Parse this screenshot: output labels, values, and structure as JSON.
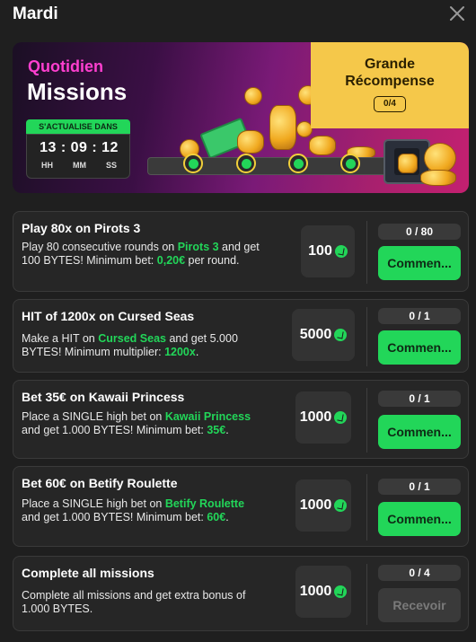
{
  "header": {
    "title": "Mardi"
  },
  "banner": {
    "heading_small": "Quotidien",
    "heading_big": "Missions",
    "timer": {
      "label": "S'ACTUALISE DANS",
      "hh": "13",
      "mm": "09",
      "ss": "12",
      "unit_h": "HH",
      "unit_m": "MM",
      "unit_s": "SS"
    },
    "reward": {
      "title_line1": "Grande",
      "title_line2": "Récompense",
      "count": "0/4"
    }
  },
  "missions": [
    {
      "title": "Play 80x on Pirots 3",
      "desc_a": "Play 80 consecutive rounds on ",
      "desc_hl1": "Pirots 3",
      "desc_b": " and get 100 BYTES! Minimum bet: ",
      "desc_hl2": "0,20€",
      "desc_c": " per round.",
      "reward": "100",
      "progress": "0 / 80",
      "button": "Commen..."
    },
    {
      "title": "HIT of 1200x on Cursed Seas",
      "desc_a": "Make a HIT on ",
      "desc_hl1": "Cursed Seas",
      "desc_b": " and get 5.000 BYTES! Minimum multiplier: ",
      "desc_hl2": "1200x",
      "desc_c": ".",
      "reward": "5000",
      "progress": "0 / 1",
      "button": "Commen..."
    },
    {
      "title": "Bet 35€ on Kawaii Princess",
      "desc_a": "Place a SINGLE high bet on ",
      "desc_hl1": "Kawaii Princess",
      "desc_b": " and get 1.000 BYTES! Minimum bet: ",
      "desc_hl2": "35€",
      "desc_c": ".",
      "reward": "1000",
      "progress": "0 / 1",
      "button": "Commen..."
    },
    {
      "title": "Bet 60€ on Betify Roulette",
      "desc_a": "Place a SINGLE high bet on ",
      "desc_hl1": "Betify Roulette",
      "desc_b": " and get 1.000 BYTES! Minimum bet: ",
      "desc_hl2": "60€",
      "desc_c": ".",
      "reward": "1000",
      "progress": "0 / 1",
      "button": "Commen..."
    },
    {
      "title": "Complete all missions",
      "desc_a": "Complete all missions and get extra bonus of 1.000 BYTES.",
      "reward": "1000",
      "progress": "0 / 4",
      "button": "Recevoir"
    }
  ],
  "colors": {
    "accent": "#22d659",
    "gold": "#f5c84a",
    "bg": "#1f1f1f",
    "card": "#262626"
  },
  "icons": [
    "close-icon",
    "bytes-coin-icon",
    "vault-icon",
    "money-icon"
  ]
}
